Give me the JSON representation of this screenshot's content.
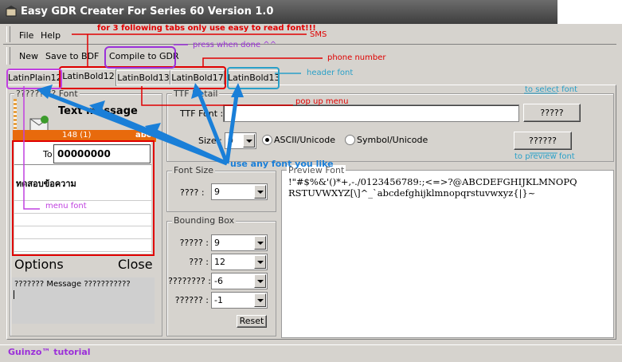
{
  "window": {
    "title": "Easy GDR Creater For Series 60 Version 1.0"
  },
  "menu": {
    "file": "File",
    "help": "Help"
  },
  "toolbar": {
    "new": "New",
    "save": "Save to BDF",
    "compile": "Compile to GDR"
  },
  "tabs": [
    "LatinPlain12",
    "LatinBold12",
    "LatinBold13",
    "LatinBold17",
    "LatinBold13"
  ],
  "phone": {
    "group_label": "?????? ?? Font",
    "title": "Text message",
    "counter": "148 (1)",
    "mode": "abc",
    "to_label": "To",
    "to_value": "00000000",
    "body_text": "ทดสอบข้อความ",
    "options": "Options",
    "close": "Close",
    "message_label": "??????? Message ???????????"
  },
  "ttf": {
    "group_label": "TTF Detail",
    "font_label": "TTF Font :",
    "font_value": "",
    "select_btn": "?????",
    "size_label": "Size :",
    "size_value": "9",
    "ascii": "ASCII/Unicode",
    "symbol": "Symbol/Unicode",
    "preview_btn": "??????"
  },
  "fontsize": {
    "group_label": "Font Size",
    "label": "???? :",
    "value": "9"
  },
  "bbox": {
    "group_label": "Bounding Box",
    "rows": [
      {
        "label": "????? :",
        "value": "9"
      },
      {
        "label": "??? :",
        "value": "12"
      },
      {
        "label": "???????? :",
        "value": "-6"
      },
      {
        "label": "?????? :",
        "value": "-1"
      }
    ],
    "reset": "Reset"
  },
  "preview": {
    "group_label": "Preview Font",
    "line1": "!\"#$%&'()*+,-./0123456789:;<=>?@ABCDEFGHIJKLMNOPQ",
    "line2": "RSTUVWXYZ[\\]^_`abcdefghijklmnopqrstuvwxyz{|}~"
  },
  "annotations": {
    "tabs_note": "for 3 following tabs only use easy to read font!!!",
    "sms": "SMS",
    "press": "press when done ^^",
    "phone_number": "phone number",
    "header_font": "header font",
    "select_font": "to select font",
    "popup_menu": "pop up menu",
    "preview_font": "to preview font",
    "any_font": "use any font you like",
    "menu_font": "menu font"
  },
  "status": {
    "text": "Guinzo™ tutorial"
  },
  "colors": {
    "red": "#e00000",
    "blue": "#1a7fd8",
    "purple": "#9b30d9",
    "orange": "#ee7a10",
    "teal": "#2aa0c8"
  }
}
